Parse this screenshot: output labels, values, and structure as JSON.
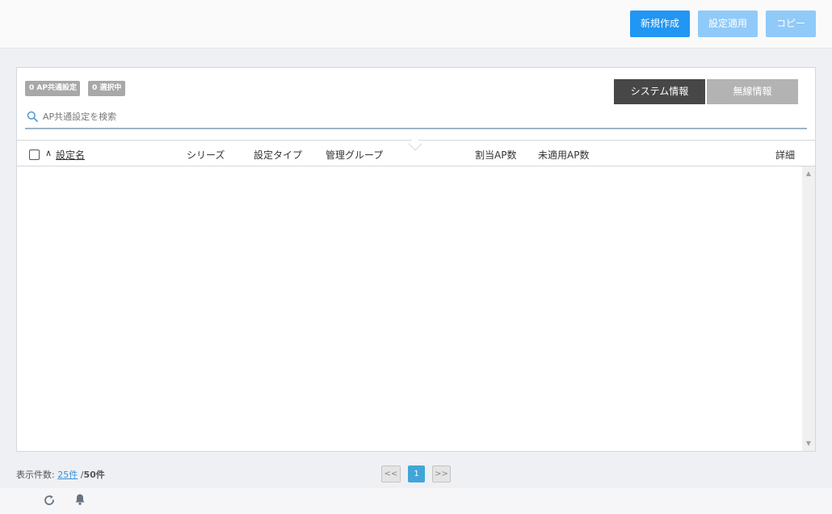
{
  "toolbar": {
    "new_label": "新規作成",
    "apply_label": "設定適用",
    "copy_label": "コピー"
  },
  "badges": {
    "common": "0 AP共通設定",
    "selected": "0 選択中"
  },
  "tabs": {
    "system": "システム情報",
    "wireless": "無線情報"
  },
  "search": {
    "placeholder": "AP共通設定を検索"
  },
  "table": {
    "columns": {
      "name": "設定名",
      "series": "シリーズ",
      "type": "設定タイプ",
      "group": "管理グループ",
      "assigned": "割当AP数",
      "unapplied": "未適用AP数",
      "detail": "詳細"
    },
    "rows": []
  },
  "footer": {
    "count_label": "表示件数:",
    "per_page": "25件",
    "separator": "/",
    "total": "50件"
  },
  "pager": {
    "prev": "<<",
    "current": "1",
    "next": ">>"
  },
  "colors": {
    "primary": "#2196f3",
    "primary_disabled": "#90caf9",
    "tab_active": "#474747",
    "tab_inactive": "#b3b3b3",
    "badge": "#a8a8a8",
    "page_active": "#42a5d8"
  },
  "icons": {
    "search": "search-icon",
    "refresh": "refresh-icon",
    "bell": "bell-icon",
    "sort": "sort-asc-icon"
  }
}
